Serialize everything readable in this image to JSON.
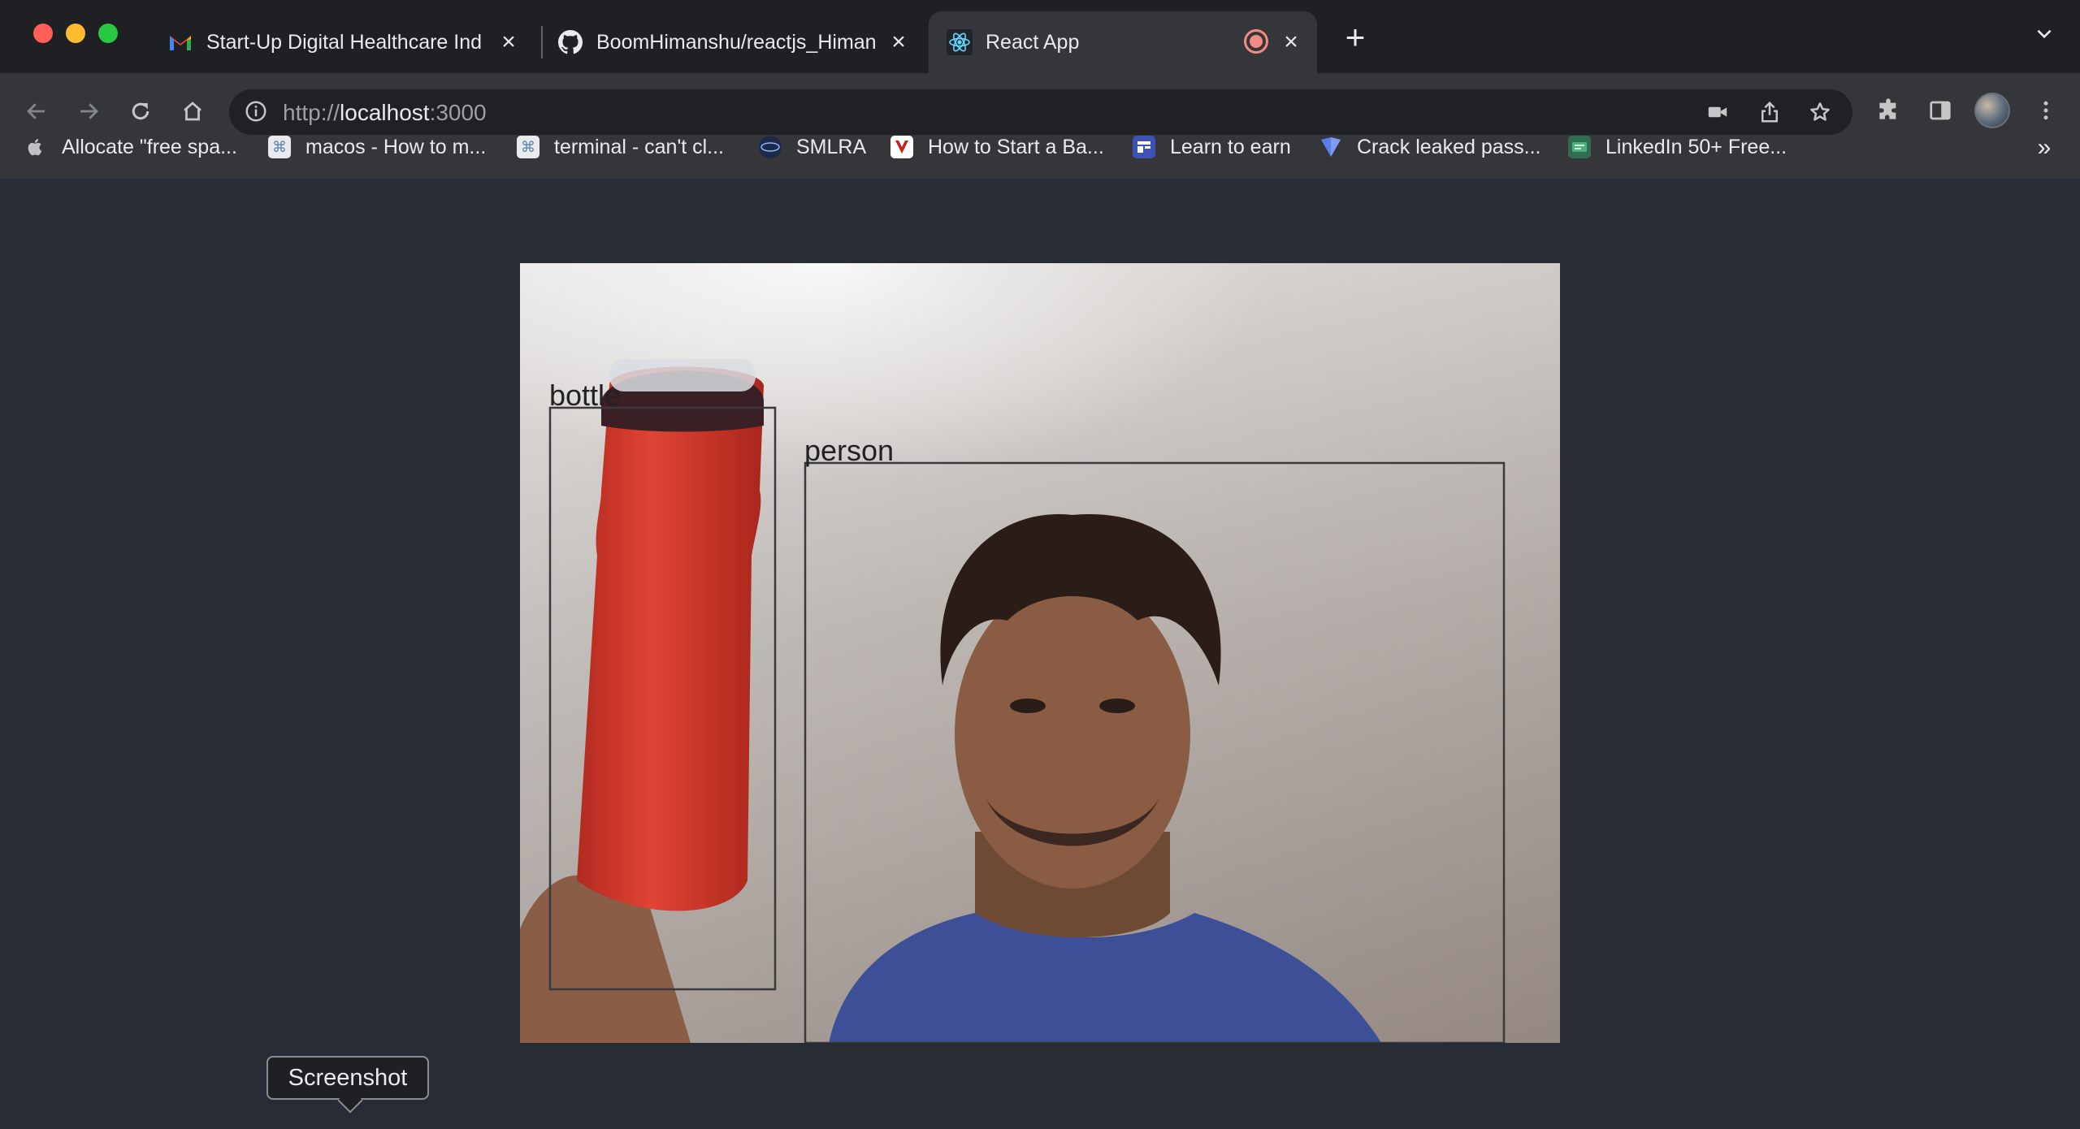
{
  "tabs": [
    {
      "title": "Start-Up Digital Healthcare Ind",
      "icon": "gmail-icon"
    },
    {
      "title": "BoomHimanshu/reactjs_Himan",
      "icon": "github-icon"
    },
    {
      "title": "React App",
      "icon": "react-icon",
      "active": true,
      "recording": true
    }
  ],
  "toolbar": {
    "url_scheme": "http://",
    "url_host": "localhost",
    "url_port": ":3000"
  },
  "bookmarks": [
    {
      "label": "Allocate \"free spa...",
      "icon": "apple-icon"
    },
    {
      "label": "macos - How to m...",
      "icon": "stackexchange-icon"
    },
    {
      "label": "terminal - can't cl...",
      "icon": "stackexchange-icon"
    },
    {
      "label": "SMLRA",
      "icon": "smlra-icon"
    },
    {
      "label": "How to Start a Ba...",
      "icon": "bookmark-site-icon"
    },
    {
      "label": "Learn to earn",
      "icon": "learn-icon"
    },
    {
      "label": "Crack leaked pass...",
      "icon": "shield-icon"
    },
    {
      "label": "LinkedIn 50+ Free...",
      "icon": "linkedin-free-icon"
    }
  ],
  "detections": [
    {
      "label": "bottle"
    },
    {
      "label": "person"
    }
  ],
  "tooltip": {
    "text": "Screenshot"
  },
  "colors": {
    "accent": "#8ab4f8",
    "page_bg": "#282c34",
    "bottle": "#d33b2c"
  }
}
